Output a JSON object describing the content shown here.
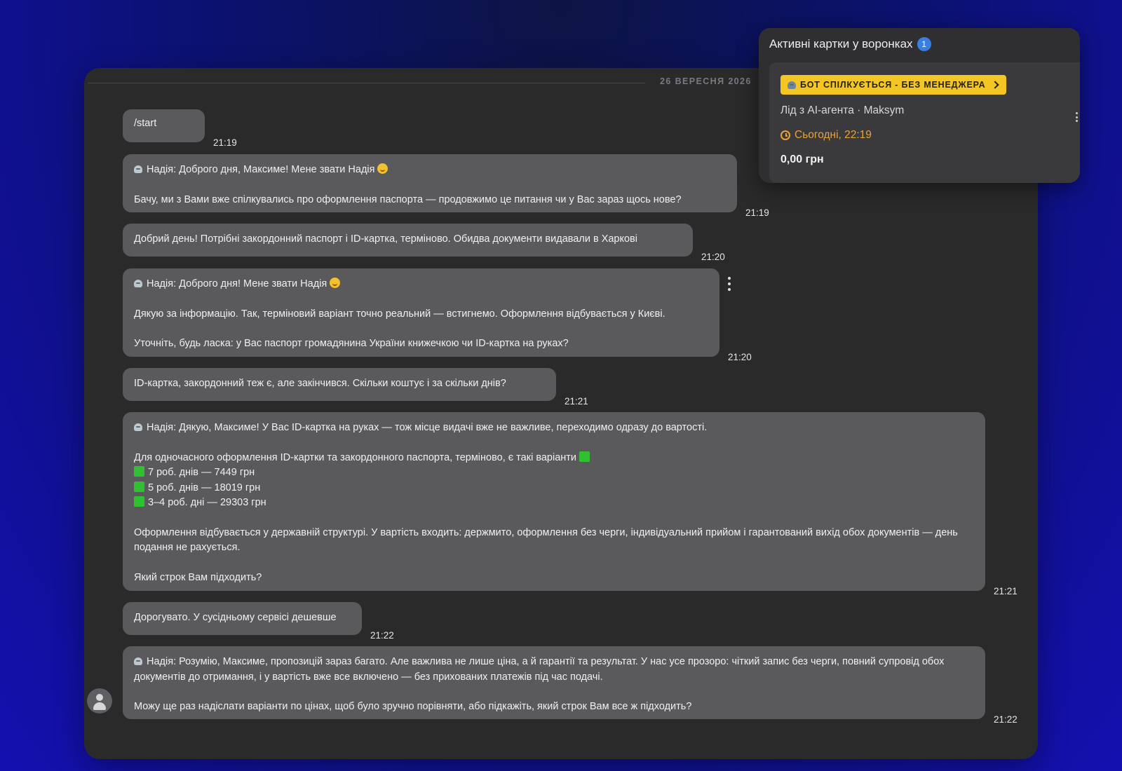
{
  "chat": {
    "date_separator": "26 ВЕРЕСНЯ 2026",
    "messages": [
      {
        "lines": [
          "/start"
        ],
        "time": "21:19"
      },
      {
        "lines": [
          "Надія: Доброго дня, Максиме! Мене звати Надія",
          "Бачу, ми з Вами вже спілкувались про оформлення паспорта — продовжимо це питання чи у Вас зараз щось нове?"
        ],
        "time": "21:19"
      },
      {
        "lines": [
          "Добрий день! Потрібні закордонний паспорт і ID-картка, терміново. Обидва документи видавали в Харкові"
        ],
        "time": "21:20"
      },
      {
        "lines": [
          "Надія: Доброго дня! Мене звати Надія",
          "Дякую за інформацію. Так, терміновий варіант точно реальний — встигнемо. Оформлення відбувається у Києві.",
          "Уточніть, будь ласка: у Вас паспорт громадянина України книжечкою чи ID-картка на руках?"
        ],
        "time": "21:20"
      },
      {
        "lines": [
          "ID-картка, закордонний теж є, але закінчився. Скільки коштує і за скільки днів?"
        ],
        "time": "21:21"
      },
      {
        "lines": [
          "Надія: Дякую, Максиме! У Вас ID-картка на руках — тож місце видачі вже не важливе, переходимо одразу до вартості.",
          "Для одночасного оформлення ID-картки та закордонного паспорта, терміново, є такі варіанти",
          "7 роб. днів — 7449 грн",
          "5 роб. днів — 18019 грн",
          "3–4 роб. дні — 29303 грн",
          "Оформлення відбувається у державній структурі. У вартість входить: держмито, оформлення без черги, індивідуальний прийом і гарантований вихід обох документів — день подання не рахується.",
          "Який строк Вам підходить?"
        ],
        "time": "21:21"
      },
      {
        "lines": [
          "Дорогувато. У сусідньому сервісі дешевше"
        ],
        "time": "21:22"
      },
      {
        "lines": [
          "Надія: Розумію, Максиме, пропозицій зараз багато. Але важлива не лише ціна, а й гарантії та результат. У нас усе прозоро: чіткий запис без черги, повний супровід обох документів до отримання, і у вартість вже все включено — без прихованих платежів під час подачі.",
          "Можу ще раз надіслати варіанти по цінах, щоб було зручно порівняти, або підкажіть, який строк Вам все ж підходить?"
        ],
        "time": "21:22"
      }
    ]
  },
  "funnels": {
    "title": "Активні картки у воронках",
    "count": "1",
    "card": {
      "status": "БОТ СПІЛКУЄТЬСЯ - БЕЗ МЕНЕДЖЕРА",
      "lead": "Лід з AI-агента · Maksym",
      "due": "Сьогодні, 22:19",
      "amount": "0,00 грн"
    }
  },
  "colors": {
    "status_chip": "#f3c623",
    "due_text": "#e8a33a",
    "count_badge": "#3a7fe0",
    "option_marker": "#2fc12f"
  },
  "icons": [
    "bot-icon",
    "smile-emoji-icon",
    "green-square-icon",
    "more-vertical-icon",
    "chevron-right-icon",
    "clock-icon",
    "user-avatar-icon"
  ]
}
